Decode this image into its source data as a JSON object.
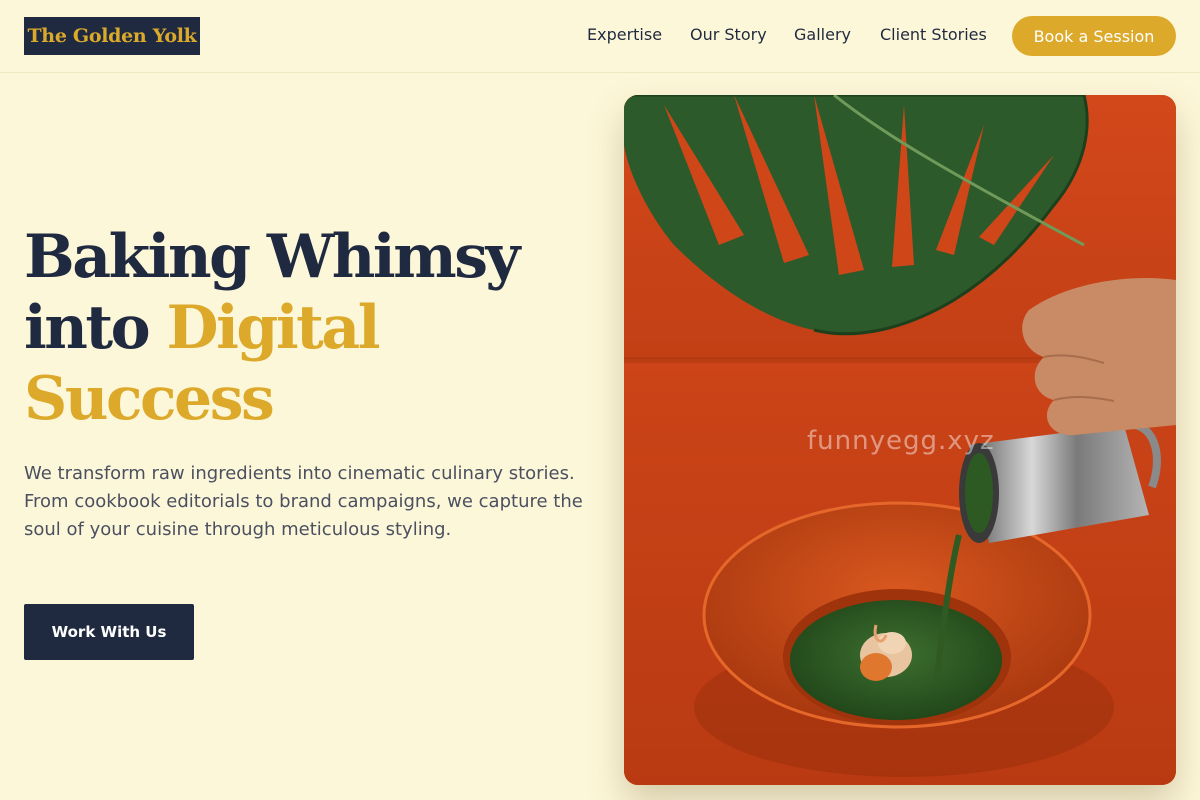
{
  "brand": {
    "logo_text": "The Golden Yolk"
  },
  "nav": {
    "items": [
      {
        "label": "Expertise"
      },
      {
        "label": "Our Story"
      },
      {
        "label": "Gallery"
      },
      {
        "label": "Client Stories"
      }
    ],
    "cta_label": "Book a Session"
  },
  "hero": {
    "headline_line1": "Baking Whimsy",
    "headline_line2_dark": "into ",
    "headline_line2_gold": "Digital",
    "headline_line3_gold": "Success",
    "intro": "We transform raw ingredients into cinematic culinary stories. From cookbook editorials to brand campaigns, we capture the soul of your cuisine through meticulous styling.",
    "cta_label": "Work With Us",
    "image_watermark": "funnyegg.xyz"
  },
  "colors": {
    "background": "#fdf7d9",
    "navy": "#1f2a40",
    "gold": "#dca92a",
    "photo_orange": "#c9461a",
    "leaf_green": "#2f5a2c"
  },
  "icons": {
    "hero_photo": "monstera-leaf-and-sauce-pour-photo"
  }
}
